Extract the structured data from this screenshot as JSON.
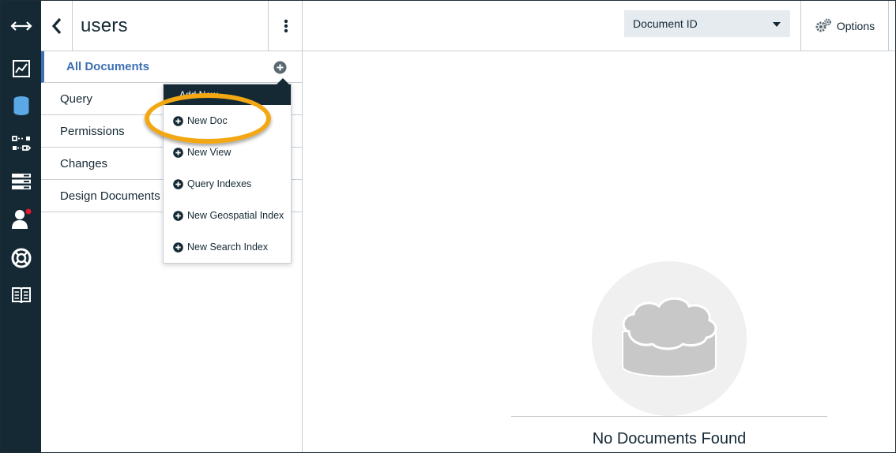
{
  "rail": {
    "items": [
      {
        "icon": "collapse-arrows-icon"
      },
      {
        "icon": "monitoring-chart-icon"
      },
      {
        "icon": "database-icon",
        "active": true
      },
      {
        "icon": "replication-icon"
      },
      {
        "icon": "server-list-icon"
      },
      {
        "icon": "user-account-icon",
        "notification": true
      },
      {
        "icon": "support-lifebuoy-icon"
      },
      {
        "icon": "documentation-book-icon"
      }
    ]
  },
  "sidebar": {
    "title": "users",
    "nav": [
      {
        "label": "All Documents",
        "active": true
      },
      {
        "label": "Query"
      },
      {
        "label": "Permissions"
      },
      {
        "label": "Changes"
      },
      {
        "label": "Design Documents"
      }
    ]
  },
  "add_menu": {
    "header": "Add New",
    "items": [
      {
        "label": "New Doc",
        "icon": "plus-circle-icon"
      },
      {
        "label": "New View",
        "icon": "plus-circle-icon"
      },
      {
        "label": "Query Indexes",
        "icon": "plus-circle-icon"
      },
      {
        "label": "New Geospatial Index",
        "icon": "plus-circle-icon"
      },
      {
        "label": "New Search Index",
        "icon": "plus-circle-icon"
      }
    ]
  },
  "topbar": {
    "select_value": "Document ID",
    "options_label": "Options"
  },
  "main": {
    "empty_message": "No Documents Found"
  },
  "colors": {
    "rail_bg": "#152935",
    "accent": "#3d70b2",
    "highlight_ring": "#f3a712",
    "select_bg": "#e6ebf0"
  }
}
